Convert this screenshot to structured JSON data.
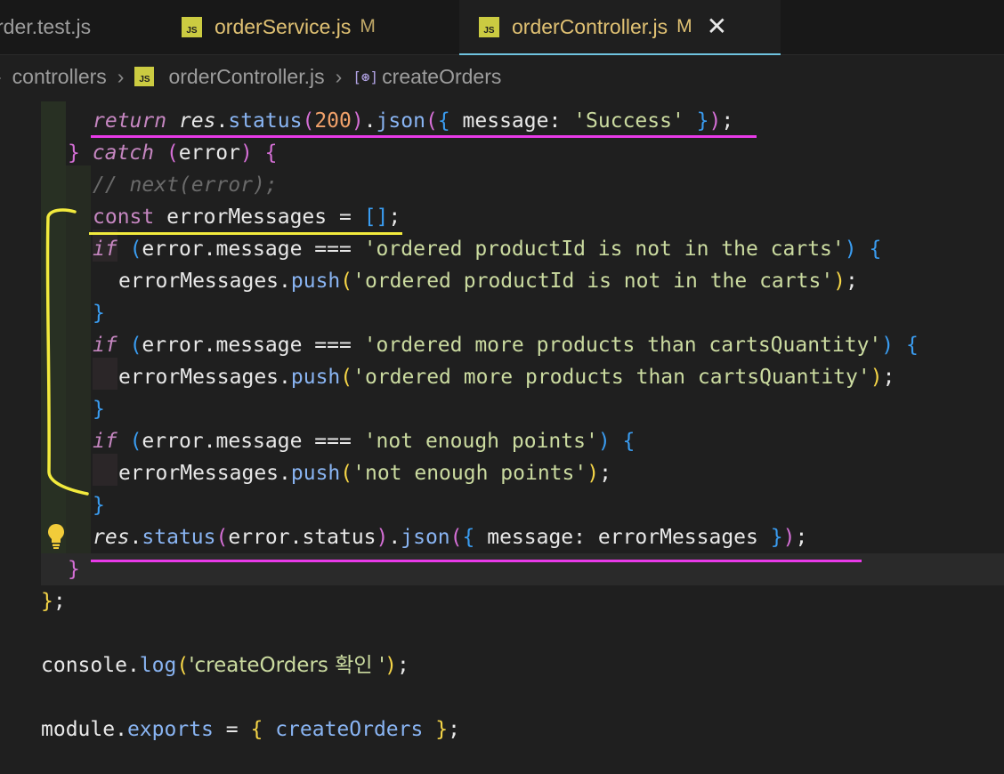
{
  "tabs": [
    {
      "label": "rder.test.js",
      "modified": ""
    },
    {
      "label": "orderService.js",
      "modified": "M"
    },
    {
      "label": "orderController.js",
      "modified": "M"
    }
  ],
  "breadcrumb": {
    "folder": "controllers",
    "file": "orderController.js",
    "symbol": "createOrders"
  },
  "editor": {
    "comment_line": "// next(error);",
    "strings": {
      "success": "'Success'",
      "not_in_carts": "'ordered productId is not in the carts'",
      "more_than_qty": "'ordered more products than cartsQuantity'",
      "not_enough": "'not enough points'",
      "console_msg": "'createOrders 확인 '"
    },
    "number_200": "200"
  },
  "icons": {
    "file_type": "js-file-icon",
    "close": "close-icon",
    "symbol": "method-symbol-icon",
    "quick_fix": "lightbulb-icon"
  },
  "colors": {
    "accent_tab_underline": "#6fc3df",
    "annotation_magenta": "#e83ae8",
    "annotation_yellow": "#f2ea3d"
  }
}
